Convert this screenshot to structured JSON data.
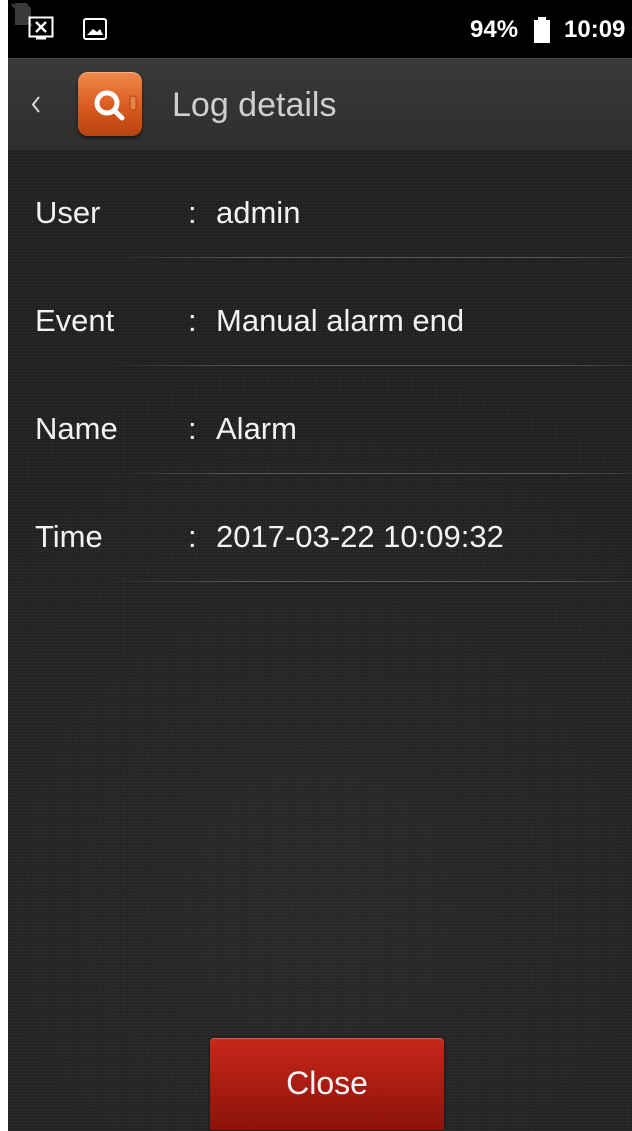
{
  "status_bar": {
    "battery_text": "94%",
    "time": "10:09",
    "icons": [
      "screenshot-icon",
      "gallery-icon",
      "no-sim-icon",
      "battery-icon"
    ]
  },
  "header": {
    "back_icon": "chevron-left-icon",
    "app_icon": "log-search-icon",
    "title": "Log details"
  },
  "details": [
    {
      "label": "User",
      "colon": ":",
      "value": "admin"
    },
    {
      "label": "Event",
      "colon": ":",
      "value": "Manual alarm end"
    },
    {
      "label": "Name",
      "colon": ":",
      "value": "Alarm"
    },
    {
      "label": "Time",
      "colon": ":",
      "value": "2017-03-22 10:09:32"
    }
  ],
  "footer": {
    "close_label": "Close"
  },
  "colors": {
    "background": "#242321",
    "status_bar": "#000000",
    "app_icon": "#d95a1e",
    "close_button": "#a81b10",
    "text": "#f2f2f2"
  }
}
